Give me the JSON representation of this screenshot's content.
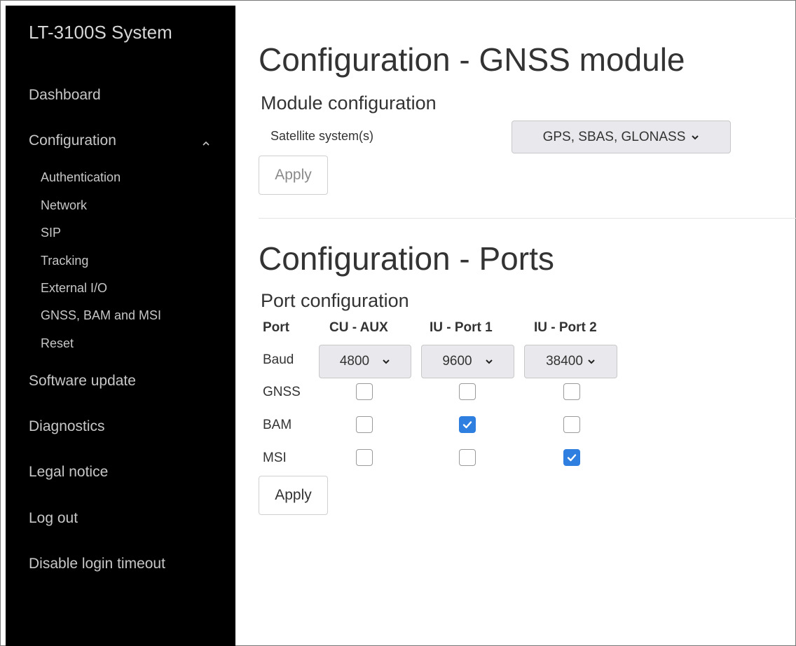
{
  "sidebar": {
    "brand": "LT-3100S System",
    "items": {
      "dashboard": "Dashboard",
      "configuration": "Configuration",
      "software_update": "Software update",
      "diagnostics": "Diagnostics",
      "legal_notice": "Legal notice",
      "log_out": "Log out",
      "disable_login_timeout": "Disable login timeout"
    },
    "config_caret_icon": "chevron-up-icon",
    "sub_items": [
      "Authentication",
      "Network",
      "SIP",
      "Tracking",
      "External I/O",
      "GNSS, BAM and MSI",
      "Reset"
    ]
  },
  "gnss": {
    "title": "Configuration - GNSS module",
    "subtitle": "Module configuration",
    "satellite_label": "Satellite system(s)",
    "satellite_value": "GPS, SBAS, GLONASS",
    "apply_label": "Apply",
    "apply_disabled": true
  },
  "ports": {
    "title": "Configuration - Ports",
    "subtitle": "Port configuration",
    "headers": [
      "Port",
      "CU - AUX",
      "IU - Port 1",
      "IU - Port 2"
    ],
    "baud_label": "Baud",
    "baud_values": [
      "4800",
      "9600",
      "38400"
    ],
    "rows": [
      {
        "label": "GNSS",
        "checked": [
          false,
          false,
          false
        ]
      },
      {
        "label": "BAM",
        "checked": [
          false,
          true,
          false
        ]
      },
      {
        "label": "MSI",
        "checked": [
          false,
          false,
          true
        ]
      }
    ],
    "apply_label": "Apply"
  },
  "colors": {
    "sidebar_bg": "#000000",
    "checkbox_checked": "#2f7fe0"
  }
}
